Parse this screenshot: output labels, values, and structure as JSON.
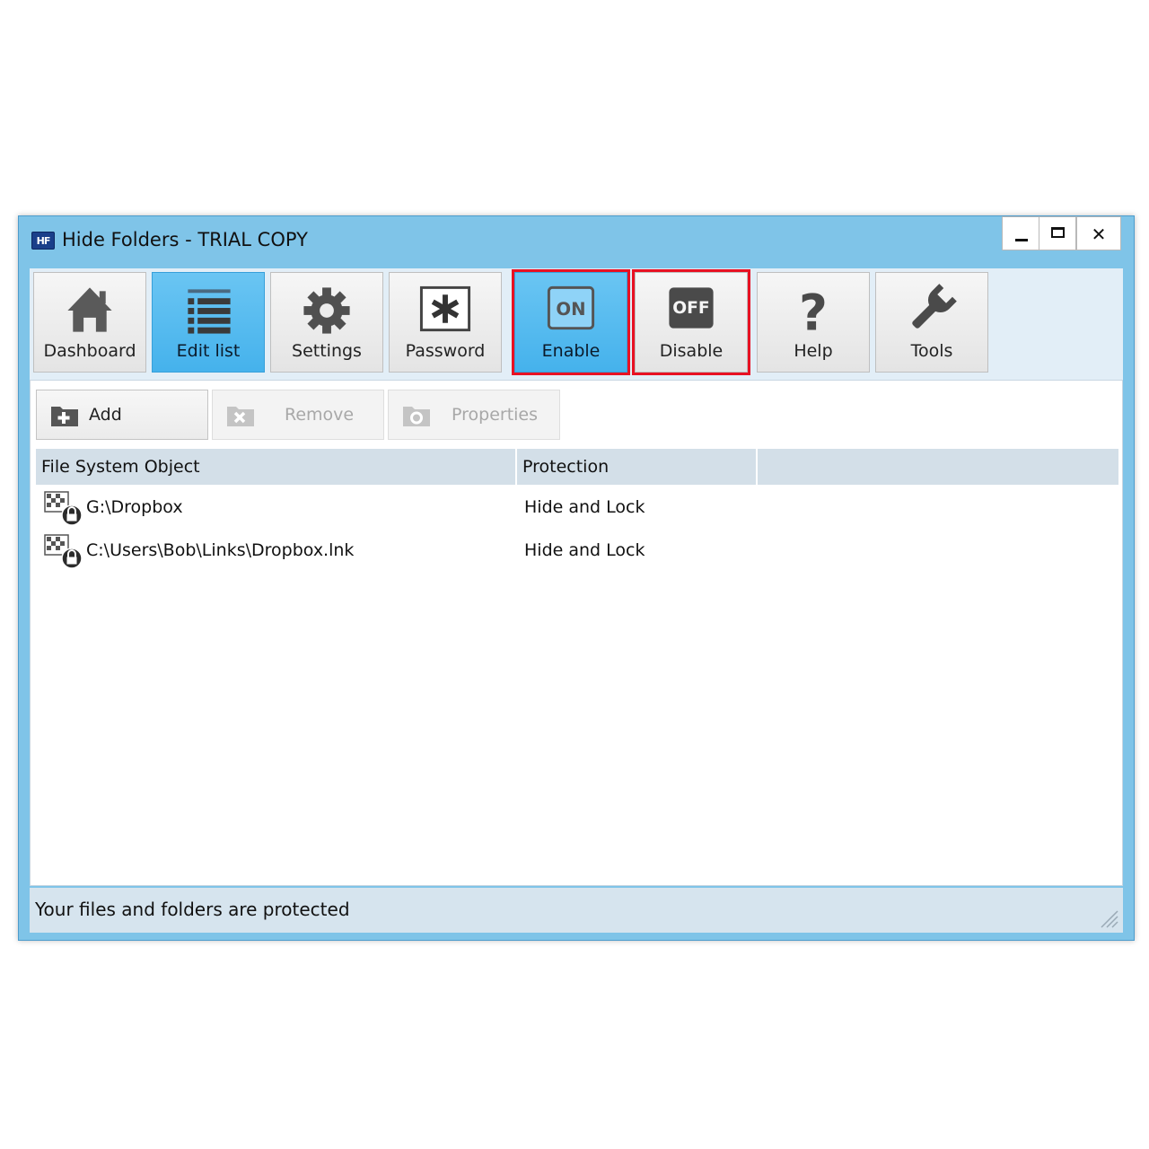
{
  "window": {
    "logo_text": "HF",
    "title": "Hide Folders - TRIAL COPY",
    "close_glyph": "✕"
  },
  "toolbar": {
    "items": [
      {
        "label": "Dashboard",
        "icon": "house-icon"
      },
      {
        "label": "Edit list",
        "icon": "list-icon",
        "active": true
      },
      {
        "label": "Settings",
        "icon": "gear-icon"
      },
      {
        "label": "Password",
        "icon": "asterisk-icon"
      },
      {
        "label": "Enable",
        "icon": "on-switch-icon",
        "icon_text": "ON"
      },
      {
        "label": "Disable",
        "icon": "off-switch-icon",
        "icon_text": "OFF"
      },
      {
        "label": "Help",
        "icon": "question-icon",
        "icon_text": "?"
      },
      {
        "label": "Tools",
        "icon": "wrench-icon"
      }
    ]
  },
  "actions": {
    "add": "Add",
    "remove": "Remove",
    "properties": "Properties"
  },
  "list": {
    "columns": [
      "File System Object",
      "Protection",
      ""
    ],
    "rows": [
      {
        "path": "G:\\Dropbox",
        "protection": "Hide and Lock"
      },
      {
        "path": "C:\\Users\\Bob\\Links\\Dropbox.lnk",
        "protection": "Hide and Lock"
      }
    ]
  },
  "status": {
    "text": "Your files and folders are protected"
  },
  "colors": {
    "frame": "#7fc4e8",
    "active_button": "#45b2ec",
    "highlight": "#e81123"
  }
}
